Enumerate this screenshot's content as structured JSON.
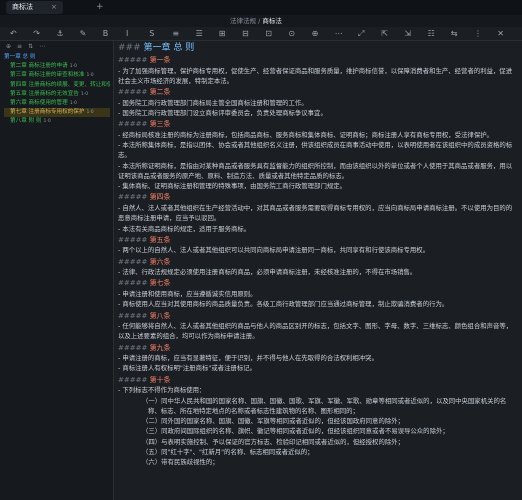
{
  "window": {
    "tab_title": "商标法",
    "tab_close": "×",
    "new_tab": "+"
  },
  "breadcrumb": {
    "parent": "法律法规 /",
    "current": "商标法"
  },
  "toolbar": [
    "↶",
    "↷",
    "⚓",
    "✎",
    "B",
    "I",
    "S",
    "≡",
    "☰",
    "⊞",
    "⊟",
    "⊡",
    "⊙",
    "⊕",
    "⋯",
    "⤢",
    "⇱",
    "⇲",
    "☷",
    "⇆",
    "⋮",
    "✕"
  ],
  "sidebar": {
    "tools": [
      "⊕",
      "≡",
      "⇅",
      "⋯"
    ],
    "items": [
      {
        "label": "第一章 总 则",
        "count": "",
        "level": "top",
        "active": false
      },
      {
        "label": "第二章 商标注册的申请",
        "count": "1·0",
        "level": "sub",
        "active": false
      },
      {
        "label": "第三章 商标注册的审查和核准",
        "count": "1·0",
        "level": "sub",
        "active": false
      },
      {
        "label": "第四章 注册商标的续展、变更、转让和使用...",
        "count": "",
        "level": "sub",
        "active": false
      },
      {
        "label": "第五章 注册商标的无效宣告",
        "count": "1·0",
        "level": "sub",
        "active": false
      },
      {
        "label": "第六章 商标使用的管理",
        "count": "1·0",
        "level": "sub",
        "active": false
      },
      {
        "label": "第七章 注册商标专用权的保护",
        "count": "1·0",
        "level": "sub",
        "active": true
      },
      {
        "label": "第八章 附 则",
        "count": "1·0",
        "level": "sub",
        "active": false
      }
    ]
  },
  "editor": {
    "chapter_hash": "###",
    "chapter_title": "第一章 总 则",
    "article_hash": "#####",
    "articles": [
      {
        "title": "第一条",
        "paras": [
          "- 为了加强商标管理，保护商标专用权，促使生产、经营者保证商品和服务质量，维护商标信誉，以保障消费者和生产、经营者的利益，促进社会主义市场经济的发展，特制定本法。"
        ],
        "items": []
      },
      {
        "title": "第二条",
        "paras": [
          "- 国务院工商行政管理部门商标局主管全国商标注册和管理的工作。",
          "- 国务院工商行政管理部门设立商标评审委员会，负责处理商标争议事宜。"
        ],
        "items": []
      },
      {
        "title": "第三条",
        "paras": [
          "- 经商标局核准注册的商标为注册商标，包括商品商标、服务商标和集体商标、证明商标；商标注册人享有商标专用权，受法律保护。",
          "- 本法所称集体商标，是指以团体、协会或者其他组织名义注册，供该组织成员在商事活动中使用，以表明使用者在该组织中的成员资格的标志。",
          "- 本法所称证明商标，是指由对某种商品或者服务具有监督能力的组织所控制，而由该组织以外的单位或者个人使用于其商品或者服务，用以证明该商品或者服务的原产地、原料、制造方法、质量或者其他特定品质的标志。",
          "- 集体商标、证明商标注册和管理的特殊事项，由国务院工商行政管理部门规定。"
        ],
        "items": []
      },
      {
        "title": "第四条",
        "paras": [
          "- 自然人、法人或者其他组织在生产经营活动中，对其商品或者服务需要取得商标专用权的，应当向商标局申请商标注册。不以使用为目的的恶意商标注册申请，应当予以驳回。",
          "- 本法有关商品商标的规定，适用于服务商标。"
        ],
        "items": []
      },
      {
        "title": "第五条",
        "paras": [
          "- 两个以上的自然人、法人或者其他组织可以共同向商标局申请注册同一商标，共同享有和行使该商标专用权。"
        ],
        "items": []
      },
      {
        "title": "第六条",
        "paras": [
          "- 法律、行政法规规定必须使用注册商标的商品，必须申请商标注册，未经核准注册的，不得在市场销售。"
        ],
        "items": []
      },
      {
        "title": "第七条",
        "paras": [
          "- 申请注册和使用商标，应当遵循诚实信用原则。",
          "- 商标使用人应当对其使用商标的商品质量负责。各级工商行政管理部门应当通过商标管理，制止欺骗消费者的行为。"
        ],
        "items": []
      },
      {
        "title": "第八条",
        "paras": [
          "- 任何能够将自然人、法人或者其他组织的商品与他人的商品区别开的标志，包括文字、图形、字母、数字、三维标志、颜色组合和声音等，以及上述要素的组合，均可以作为商标申请注册。"
        ],
        "items": []
      },
      {
        "title": "第九条",
        "paras": [
          "- 申请注册的商标，应当有显著特征，便于识别，并不得与他人在先取得的合法权利相冲突。",
          "- 商标注册人有权标明\"注册商标\"或者注册标记。"
        ],
        "items": []
      },
      {
        "title": "第十条",
        "paras": [
          "- 下列标志不得作为商标使用："
        ],
        "items": [
          "（一）同中华人民共和国的国家名称、国旗、国徽、国歌、军旗、军徽、军歌、勋章等相同或者近似的，以及同中央国家机关的名称、标志、所在地特定地点的名称或者标志性建筑物的名称、图形相同的；",
          "（二）同外国的国家名称、国旗、国徽、军旗等相同或者近似的，但经该国政府同意的除外；",
          "（三）同政府间国际组织的名称、旗帜、徽记等相同或者近似的，但经该组织同意或者不易误导公众的除外；",
          "（四）与表明实施控制、予以保证的官方标志、检验印记相同或者近似的，但经授权的除外；",
          "（五）同\"红十字\"、\"红新月\"的名称、标志相同或者近似的；",
          "（六）带有民族歧视性的；"
        ]
      }
    ]
  }
}
